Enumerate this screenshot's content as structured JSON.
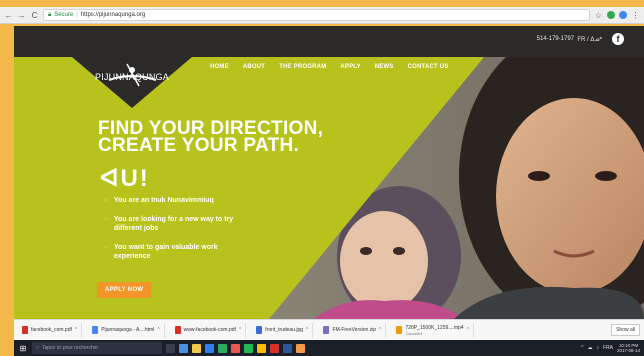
{
  "browser": {
    "back": "←",
    "forward": "→",
    "reload": "C",
    "secure_label": "Secure",
    "url": "https://pijunnaqunga.org",
    "star": "☆"
  },
  "site": {
    "phone": "514-179-1797",
    "lang": "FR / ᐃᓄᒃ",
    "facebook": "f",
    "logo_text": "PIJUNNAQUNGA",
    "nav": [
      "HOME",
      "ABOUT",
      "THE PROGRAM",
      "APPLY",
      "NEWS",
      "CONTACT US"
    ],
    "headline_1": "FIND YOUR DIRECTION,",
    "headline_2": "CREATE YOUR PATH.",
    "syllabics": "ᐊU!",
    "bullets": [
      "You are an Inuk Nunavimmiuq",
      "You are looking for a new way to try different jobs",
      "You want to gain valuable work experience"
    ],
    "apply_now": "APPLY NOW",
    "colors": {
      "lime": "#b7c21c",
      "dark": "#2b2a28",
      "orange": "#f3962a"
    }
  },
  "downloads": {
    "items": [
      {
        "name": "facebook_com.pdf",
        "color": "#d93025",
        "sub": ""
      },
      {
        "name": "Pijunnaqunga - A....html",
        "color": "#4285f4",
        "sub": ""
      },
      {
        "name": "www-facebook-com.pdf",
        "color": "#d93025",
        "sub": ""
      },
      {
        "name": "front_trudeau.jpg",
        "color": "#3b6fd6",
        "sub": ""
      },
      {
        "name": "FM-FreeVersion.zip",
        "color": "#7d6cc6",
        "sub": ""
      },
      {
        "name": "720P_1500K_1259....mp4",
        "color": "#f29900",
        "sub": "Canceled"
      }
    ],
    "show_all": "Show all"
  },
  "taskbar": {
    "search_placeholder": "Tapez ici pour rechercher",
    "lang": "FRA",
    "time": "10:10 PM",
    "date": "2017-08-14"
  }
}
